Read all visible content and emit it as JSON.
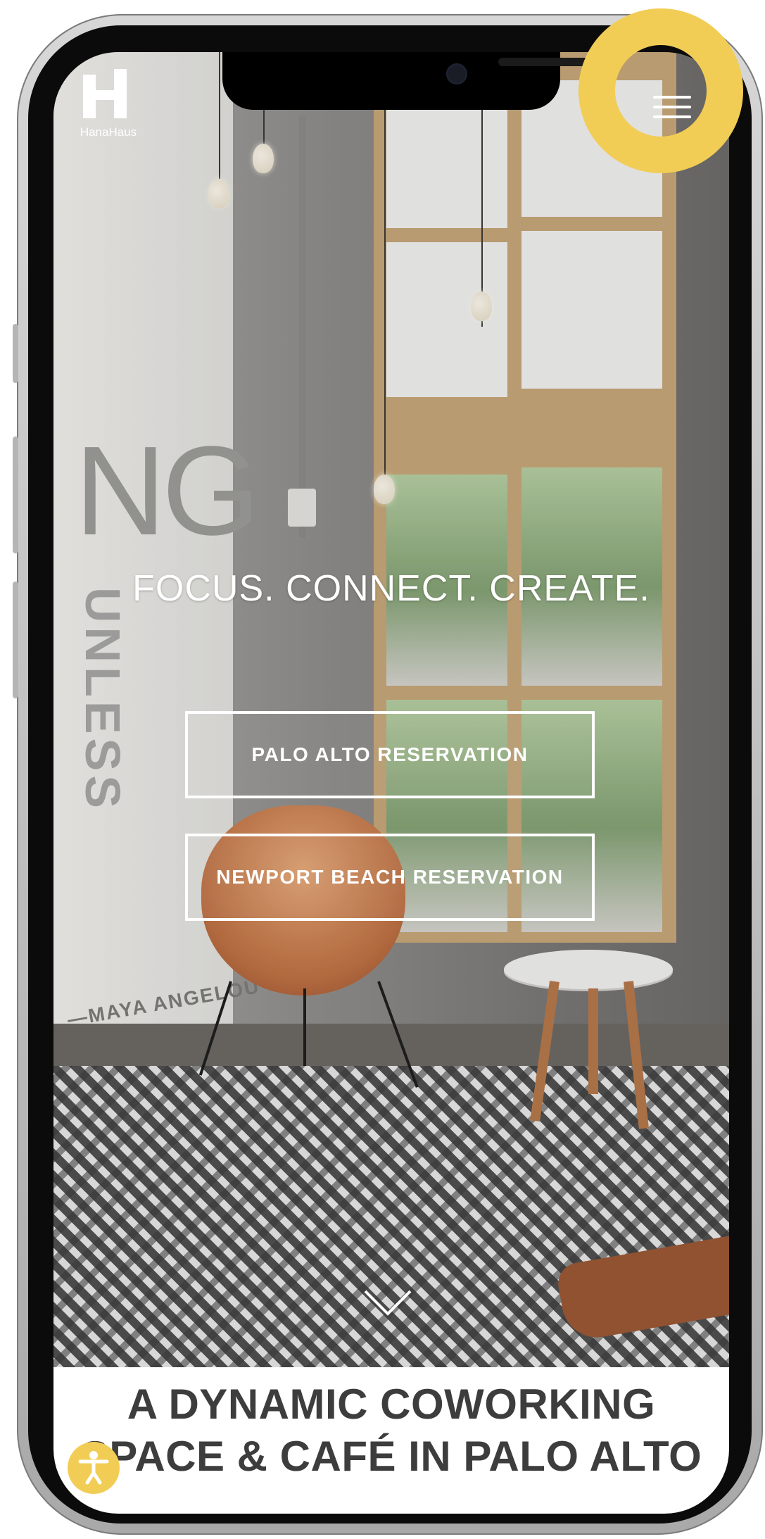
{
  "header": {
    "logo_text": "HanaHaus",
    "menu_icon": "hamburger-menu-icon"
  },
  "hero": {
    "tagline": "FOCUS. CONNECT. CREATE.",
    "buttons": [
      {
        "label": "PALO ALTO RESERVATION"
      },
      {
        "label": "NEWPORT BEACH RESERVATION"
      }
    ],
    "scroll_icon": "chevron-down-icon",
    "wall_lettering": "NG",
    "wall_lettering_vertical": "UNLESS",
    "wall_quote_author": "—MAYA ANGELOU"
  },
  "section": {
    "title_line1": "A DYNAMIC COWORKING",
    "title_line2": "SPACE & CAFÉ IN PALO ALTO"
  },
  "accessibility": {
    "icon": "accessibility-icon"
  },
  "colors": {
    "highlight": "#f2cd55",
    "heading_text": "#3d3d3d",
    "button_border": "#ffffff"
  }
}
